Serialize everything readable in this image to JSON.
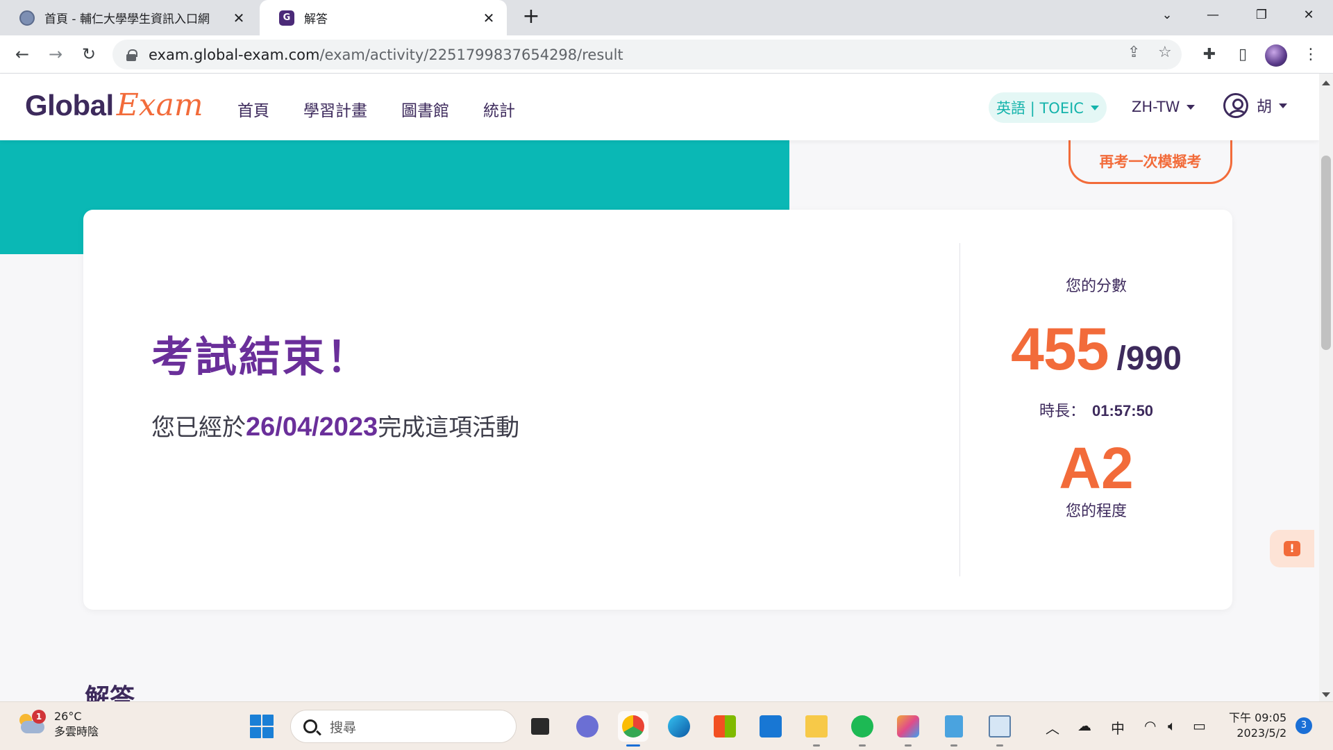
{
  "browser": {
    "tabs": [
      {
        "title": "首頁 - 輔仁大學學生資訊入口網",
        "active": false
      },
      {
        "title": "解答",
        "active": true
      }
    ],
    "url_host": "exam.global-exam.com",
    "url_path": "/exam/activity/2251799837654298/result",
    "tab_close_symbol": "✕",
    "new_tab_symbol": "+"
  },
  "site": {
    "logo_global": "Global",
    "logo_exam": "Exam",
    "nav": [
      "首頁",
      "學習計畫",
      "圖書館",
      "統計"
    ],
    "language_selector": "英語 | TOEIC",
    "locale": "ZH-TW",
    "user_name": "胡"
  },
  "result": {
    "retake_button": "再考一次模擬考",
    "title": "考試結束！",
    "completed_prefix": "您已經於",
    "completed_date": "26/04/2023",
    "completed_suffix": "完成這項活動",
    "score_label": "您的分數",
    "score": "455",
    "score_max": "/990",
    "duration_label": "時長：",
    "duration_value": "01:57:50",
    "level": "A2",
    "level_label": "您的程度"
  },
  "answers_heading": "解答",
  "feedback_symbol": "!",
  "taskbar": {
    "weather_temp": "26°C",
    "weather_desc": "多雲時陰",
    "weather_badge": "1",
    "search_placeholder": "搜尋",
    "ime": "中",
    "time": "下午 09:05",
    "date": "2023/5/2",
    "notifications": "3"
  },
  "colors": {
    "brand_purple": "#6a2f9a",
    "brand_orange": "#f26b3a",
    "teal": "#0ab8b5",
    "navy": "#3d2a5c"
  }
}
